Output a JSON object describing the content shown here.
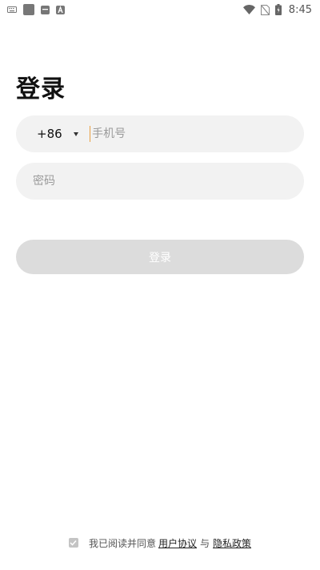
{
  "status_bar": {
    "time": "8:45",
    "left_icons": [
      "keyboard-icon",
      "square-notification-icon",
      "inbox-icon",
      "a-app-icon"
    ],
    "right_icons": [
      "wifi-icon",
      "no-sim-icon",
      "battery-icon"
    ]
  },
  "page": {
    "title": "登录"
  },
  "phone_input": {
    "country_code": "+86",
    "placeholder": "手机号",
    "value": ""
  },
  "password_input": {
    "placeholder": "密码",
    "value": ""
  },
  "login_button": {
    "label": "登录",
    "enabled": false
  },
  "agreement": {
    "checked": true,
    "prefix": "我已阅读并同意",
    "user_agreement": "用户协议",
    "and": "与",
    "privacy_policy": "隐私政策"
  },
  "colors": {
    "field_background": "#f2f2f2",
    "button_disabled": "#dcdcdc",
    "cursor": "#e8a040",
    "checkbox": "#c4c4c4"
  }
}
